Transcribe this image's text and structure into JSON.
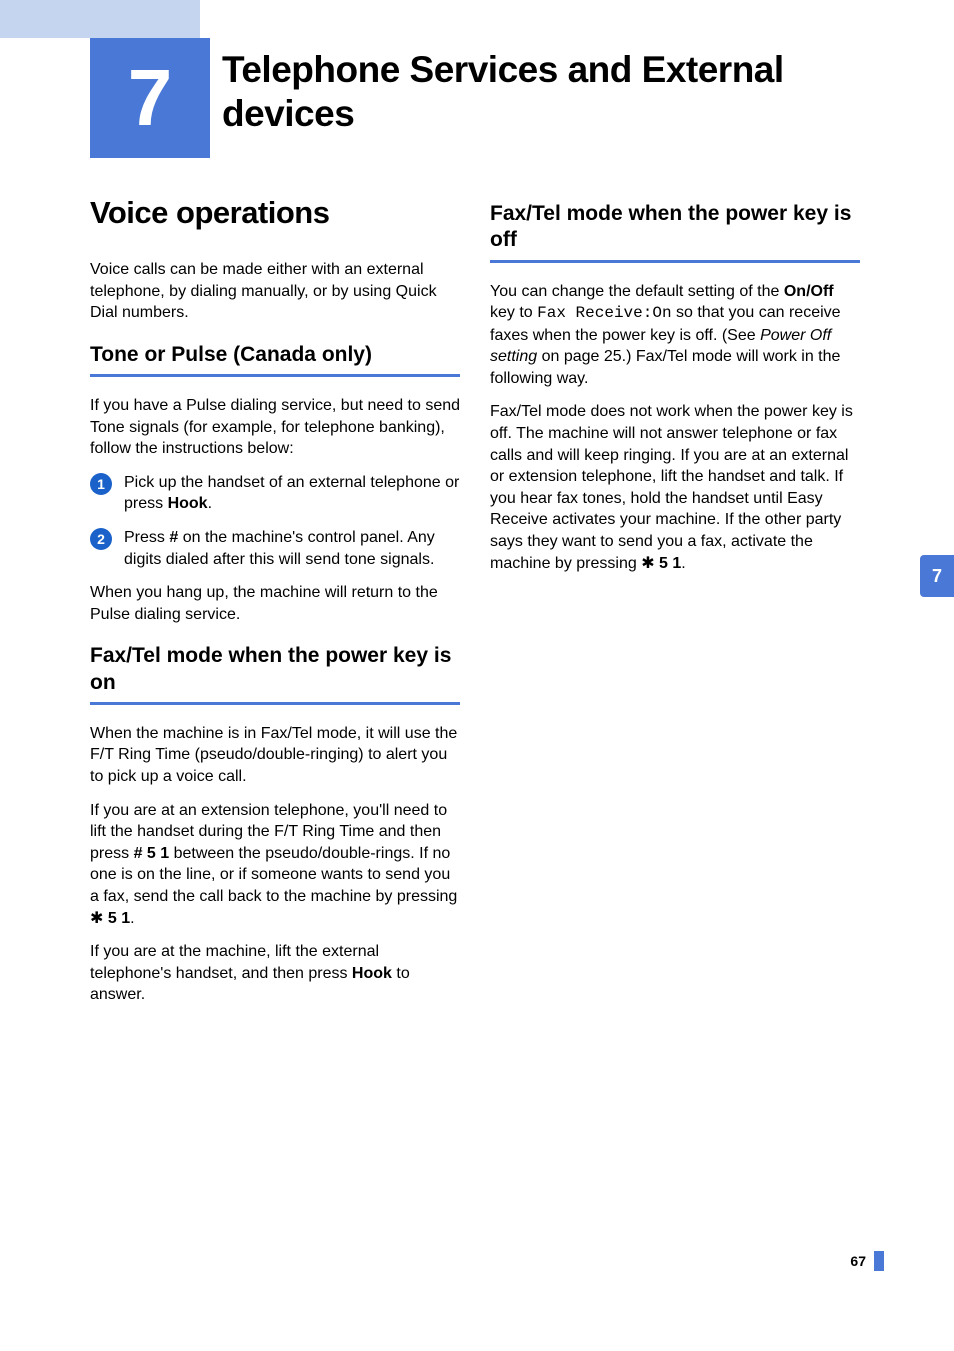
{
  "chapter": {
    "number": "7",
    "title": "Telephone Services and External devices"
  },
  "sideTab": "7",
  "pageNumber": "67",
  "left": {
    "h1": "Voice operations",
    "intro": "Voice calls can be made either with an external telephone, by dialing manually, or by using Quick Dial numbers.",
    "section1": {
      "heading": "Tone or Pulse (Canada only)",
      "intro": "If you have a Pulse dialing service, but need to send Tone signals (for example, for telephone banking), follow the instructions below:",
      "steps": [
        {
          "num": "1",
          "pre": "Pick up the handset of an external telephone or press ",
          "bold": "Hook",
          "post": "."
        },
        {
          "num": "2",
          "pre": "Press ",
          "bold": "#",
          "post": " on the machine's control panel. Any digits dialed after this will send tone signals."
        }
      ],
      "outro": "When you hang up, the machine will return to the Pulse dialing service."
    },
    "section2": {
      "heading": "Fax/Tel mode when the power key is on",
      "p1": "When the machine is in Fax/Tel mode, it will use the F/T Ring Time (pseudo/double-ringing) to alert you to pick up a voice call.",
      "p2a": "If you are at an extension telephone, you'll need to lift the handset during the F/T Ring Time and then press ",
      "p2b": "# 5 1",
      "p2c": " between the pseudo/double-rings. If no one is on the line, or if someone wants to send you a fax, send the call back to the machine by pressing ",
      "p2d": "5 1",
      "p2e": ".",
      "p3a": "If you are at the machine, lift the external telephone's handset, and then press ",
      "p3b": "Hook",
      "p3c": " to answer."
    }
  },
  "right": {
    "section1": {
      "heading": "Fax/Tel mode when the power key is off",
      "p1a": "You can change the default setting of the ",
      "p1b": "On/Off",
      "p1c": " key to ",
      "p1d": "Fax Receive:On",
      "p1e": " so that you can receive faxes when the power key is off. (See ",
      "p1f": "Power Off setting",
      "p1g": " on page 25.) Fax/Tel mode will work in the following way.",
      "p2a": "Fax/Tel mode does not work when the power key is off. The machine will not answer telephone or fax calls and will keep ringing. If you are at an external or extension telephone, lift the handset and talk. If you hear fax tones, hold the handset until Easy Receive activates your machine. If the other party says they want to send you a fax, activate the machine by pressing ",
      "p2b": "5 1",
      "p2c": "."
    }
  }
}
